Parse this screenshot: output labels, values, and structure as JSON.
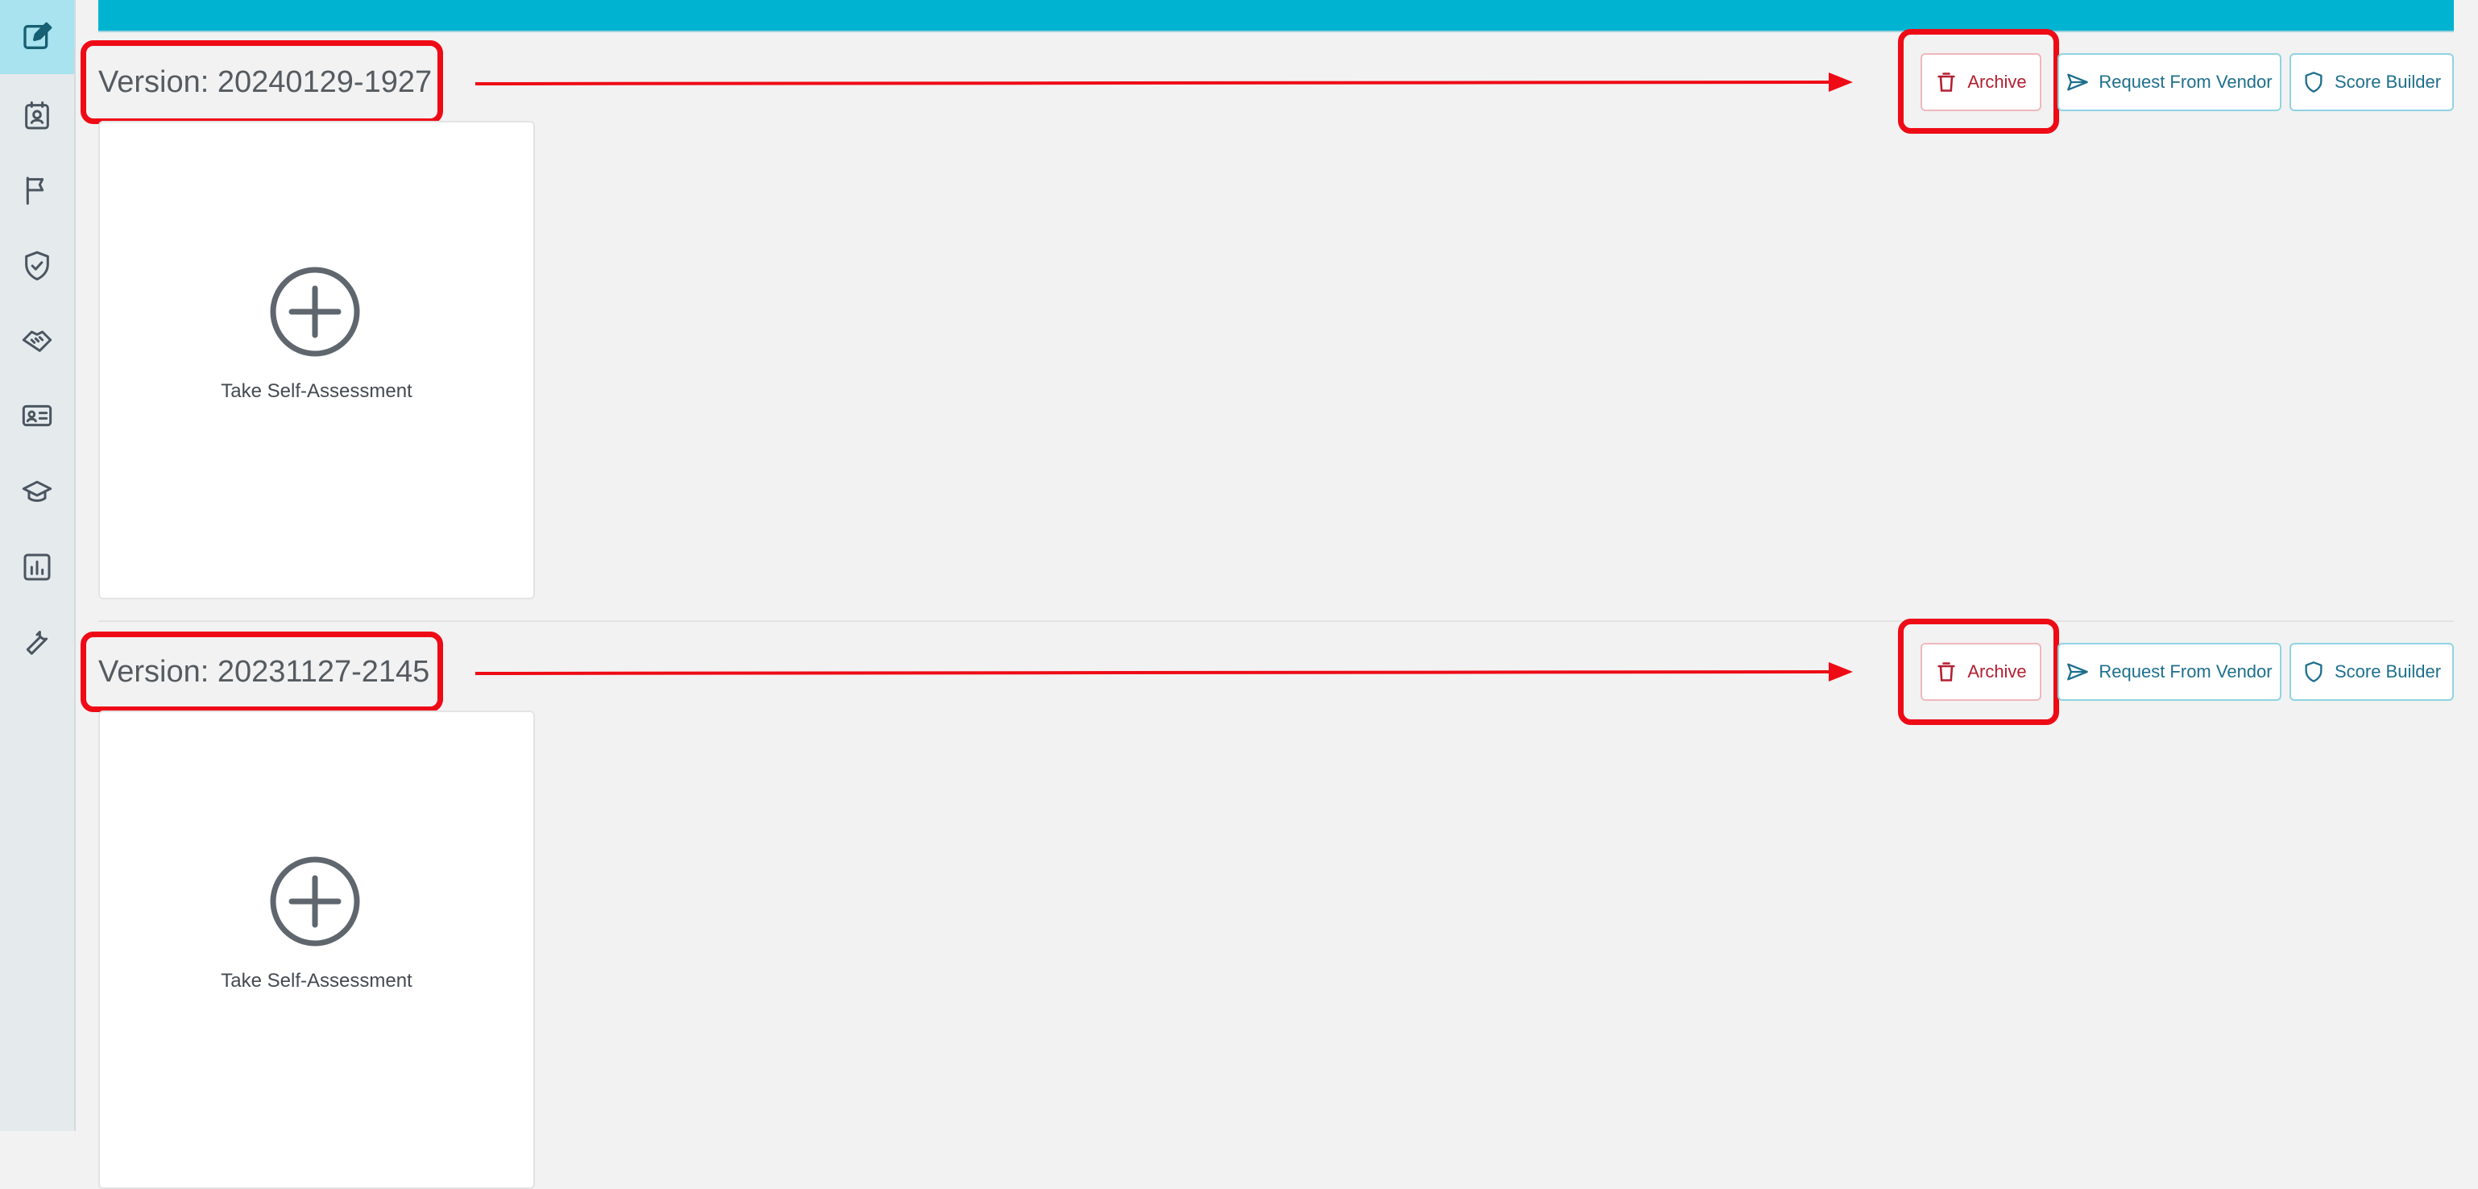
{
  "sidebar": {
    "items": [
      {
        "icon": "edit-icon",
        "active": true
      },
      {
        "icon": "contact-card-icon",
        "active": false
      },
      {
        "icon": "flag-icon",
        "active": false
      },
      {
        "icon": "shield-check-icon",
        "active": false
      },
      {
        "icon": "handshake-icon",
        "active": false
      },
      {
        "icon": "id-card-icon",
        "active": false
      },
      {
        "icon": "graduation-cap-icon",
        "active": false
      },
      {
        "icon": "bar-chart-icon",
        "active": false
      },
      {
        "icon": "wrench-icon",
        "active": false
      }
    ]
  },
  "versions": [
    {
      "title": "Version: 20240129-1927",
      "card_label": "Take Self-Assessment",
      "archive_label": "Archive",
      "request_label": "Request From Vendor",
      "score_label": "Score Builder"
    },
    {
      "title": "Version: 20231127-2145",
      "card_label": "Take Self-Assessment",
      "archive_label": "Archive",
      "request_label": "Request From Vendor",
      "score_label": "Score Builder"
    }
  ],
  "colors": {
    "accent": "#00b3d1",
    "archive": "#b31f30",
    "action": "#1d6f8c",
    "annotation": "#ee0b16"
  }
}
